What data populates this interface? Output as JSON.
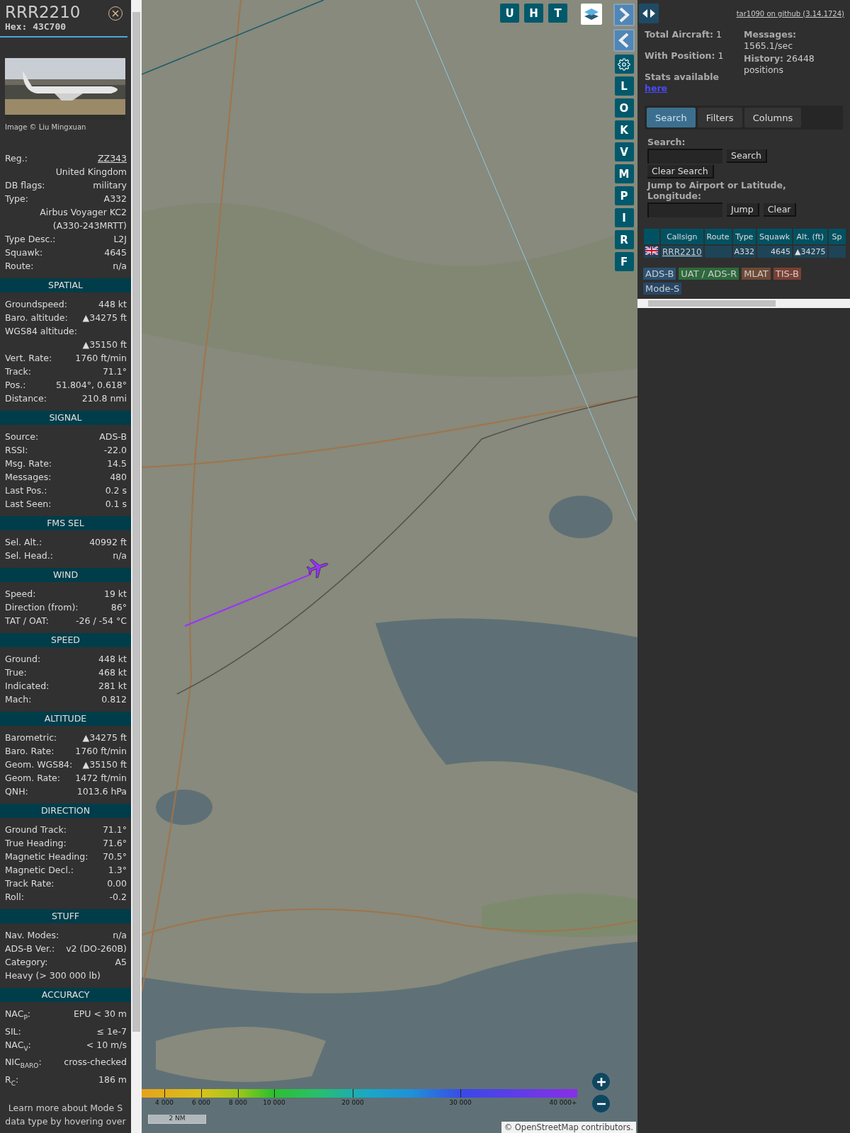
{
  "detail": {
    "callsign": "RRR2210",
    "hex": "Hex: 43C700",
    "photo_caption": "Image © Liu Mingxuan",
    "sections": [
      {
        "rows": [
          {
            "label": "Reg.:",
            "value": "ZZ343",
            "kind": "link"
          },
          {
            "value": "United Kingdom"
          },
          {
            "label": "DB flags:",
            "value": "military"
          },
          {
            "label": "Type:",
            "value": "A332"
          },
          {
            "value": "Airbus Voyager KC2 (A330-243MRTT)"
          },
          {
            "label": "Type Desc.:",
            "value": "L2J"
          },
          {
            "label": "Squawk:",
            "value": "4645"
          },
          {
            "label": "Route:",
            "value": "n/a"
          }
        ]
      },
      {
        "title": "SPATIAL",
        "rows": [
          {
            "label": "Groundspeed:",
            "value": "448 kt"
          },
          {
            "label": "Baro. altitude:",
            "value": "▲34275 ft"
          },
          {
            "label": "WGS84 altitude:"
          },
          {
            "value": "▲35150 ft"
          },
          {
            "label": "Vert. Rate:",
            "value": "1760 ft/min"
          },
          {
            "label": "Track:",
            "value": "71.1°"
          },
          {
            "label": "Pos.:",
            "value": "51.804°, 0.618°"
          },
          {
            "label": "Distance:",
            "value": "210.8 nmi"
          }
        ]
      },
      {
        "title": "SIGNAL",
        "rows": [
          {
            "label": "Source:",
            "value": "ADS-B"
          },
          {
            "label": "RSSI:",
            "value": "-22.0"
          },
          {
            "label": "Msg. Rate:",
            "value": "14.5"
          },
          {
            "label": "Messages:",
            "value": "480"
          },
          {
            "label": "Last Pos.:",
            "value": "0.2 s"
          },
          {
            "label": "Last Seen:",
            "value": "0.1 s"
          }
        ]
      },
      {
        "title": "FMS SEL",
        "rows": [
          {
            "label": "Sel. Alt.:",
            "value": "40992 ft"
          },
          {
            "label": "Sel. Head.:",
            "value": "n/a"
          }
        ]
      },
      {
        "title": "WIND",
        "rows": [
          {
            "label": "Speed:",
            "value": "19 kt"
          },
          {
            "label": "Direction (from):",
            "value": "86°"
          },
          {
            "label": "TAT / OAT:",
            "value": "-26 / -54 °C"
          }
        ]
      },
      {
        "title": "SPEED",
        "rows": [
          {
            "label": "Ground:",
            "value": "448 kt"
          },
          {
            "label": "True:",
            "value": "468 kt"
          },
          {
            "label": "Indicated:",
            "value": "281 kt"
          },
          {
            "label": "Mach:",
            "value": "0.812"
          }
        ]
      },
      {
        "title": "ALTITUDE",
        "rows": [
          {
            "label": "Barometric:",
            "value": "▲34275 ft"
          },
          {
            "label": "Baro. Rate:",
            "value": "1760 ft/min"
          },
          {
            "label": "Geom. WGS84:",
            "value": "▲35150 ft"
          },
          {
            "label": "Geom. Rate:",
            "value": "1472 ft/min"
          },
          {
            "label": "QNH:",
            "value": "1013.6 hPa"
          }
        ]
      },
      {
        "title": "DIRECTION",
        "rows": [
          {
            "label": "Ground Track:",
            "value": "71.1°"
          },
          {
            "label": "True Heading:",
            "value": "71.6°"
          },
          {
            "label": "Magnetic Heading:",
            "value": "70.5°"
          },
          {
            "label": "Magnetic Decl.:",
            "value": "1.3°"
          },
          {
            "label": "Track Rate:",
            "value": "0.00"
          },
          {
            "label": "Roll:",
            "value": "-0.2"
          }
        ]
      },
      {
        "title": "STUFF",
        "rows": [
          {
            "label": "Nav. Modes:",
            "value": "n/a"
          },
          {
            "label": "ADS-B Ver.:",
            "value": "v2 (DO-260B)"
          },
          {
            "label": "Category:",
            "value": "A5"
          },
          {
            "label": "Heavy (> 300 000 lb)"
          }
        ]
      },
      {
        "title": "ACCURACY",
        "rows": [
          {
            "label": "NAC$_{P}$:",
            "value": "EPU < 30 m"
          },
          {
            "label": "SIL:",
            "value": "≤ 1e-7"
          },
          {
            "label": "NAC$_{V}$:",
            "value": "< 10 m/s"
          },
          {
            "label": "NIC$_{BARO}$:",
            "value": "cross-checked"
          },
          {
            "label": "R$_{C}$:",
            "value": "186 m"
          }
        ]
      }
    ],
    "footer": "Learn more about Mode S data type by hovering over"
  },
  "map": {
    "top_buttons": [
      "U",
      "H",
      "T"
    ],
    "side_buttons": [
      {
        "kind": "forward"
      },
      {
        "kind": "back"
      },
      {
        "kind": "settings"
      },
      {
        "kind": "letter",
        "label": "L"
      },
      {
        "kind": "letter",
        "label": "O"
      },
      {
        "kind": "letter",
        "label": "K"
      },
      {
        "kind": "letter",
        "label": "V"
      },
      {
        "kind": "letter",
        "label": "M"
      },
      {
        "kind": "letter",
        "label": "P"
      },
      {
        "kind": "letter",
        "label": "I"
      },
      {
        "kind": "letter",
        "label": "R"
      },
      {
        "kind": "letter",
        "label": "F"
      }
    ],
    "legend_ticks": [
      "4 000",
      "6 000",
      "8 000",
      "10 000",
      "20 000",
      "30 000",
      "40 000+"
    ],
    "scale": "2 NM",
    "attribution": {
      "prefix": "©",
      "link": "OpenStreetMap",
      "suffix": "contributors."
    }
  },
  "sidebar": {
    "github_link": "tar1090 on github (3.14.1724)",
    "stats_left": [
      {
        "label": "Total Aircraft:",
        "value": "1"
      },
      {
        "label": "With Position:",
        "value": "1"
      }
    ],
    "stats_right": [
      {
        "label": "Messages:",
        "value": "1565.1/sec"
      },
      {
        "label": "History:",
        "value": "26448 positions"
      }
    ],
    "stats_note": "Stats available",
    "stats_link": "here",
    "tabs": [
      {
        "label": "Search",
        "selected": true
      },
      {
        "label": "Filters",
        "selected": false
      },
      {
        "label": "Columns",
        "selected": false
      }
    ],
    "search": {
      "label": "Search:",
      "search_button": "Search",
      "clear_button": "Clear Search",
      "jump_label": "Jump to Airport or Latitude, Longitude:",
      "jump_button": "Jump",
      "clear_jump_button": "Clear"
    },
    "table": {
      "columns": [
        "Callsign",
        "Route",
        "Type",
        "Squawk",
        "Alt. (ft)",
        "Sp"
      ],
      "rows": [
        {
          "callsign": "RRR2210",
          "type": "A332",
          "squawk": "4645",
          "altitude": "▲34275"
        }
      ]
    },
    "sources": [
      {
        "label": "ADS-B",
        "color": "#2c5273"
      },
      {
        "label": "UAT / ADS-R",
        "color": "#2e6a3c"
      },
      {
        "label": "MLAT",
        "color": "#6e4a35"
      },
      {
        "label": "TIS-B",
        "color": "#7a4034"
      },
      {
        "label": "Mode-S",
        "color": "#284766"
      }
    ]
  }
}
